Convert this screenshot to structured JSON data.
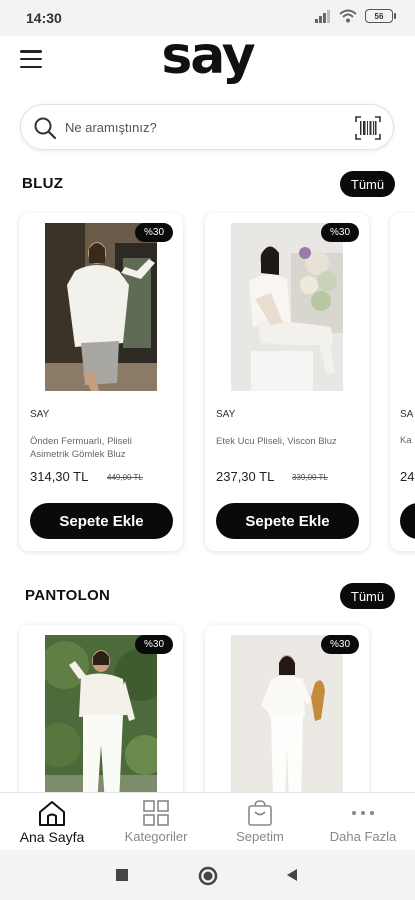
{
  "status": {
    "time": "14:30",
    "battery": "56"
  },
  "header": {
    "logo": "say"
  },
  "search": {
    "placeholder": "Ne aramıştınız?"
  },
  "sections": [
    {
      "title": "BLUZ",
      "all_label": "Tümü",
      "products": [
        {
          "badge": "%30",
          "brand": "SAY",
          "name": "Önden Fermuarlı, Pliseli Asimetrik Gömlek Bluz",
          "price": "314,30 TL",
          "old_price": "449,00 TL",
          "cart_label": "Sepete Ekle"
        },
        {
          "badge": "%30",
          "brand": "SAY",
          "name": "Etek Ucu Pliseli, Viscon Bluz",
          "price": "237,30 TL",
          "old_price": "339,00 TL",
          "cart_label": "Sepete Ekle"
        }
      ],
      "peek": {
        "brand": "SA",
        "name": "Ka",
        "price": "24"
      }
    },
    {
      "title": "PANTOLON",
      "all_label": "Tümü",
      "products": [
        {
          "badge": "%30"
        },
        {
          "badge": "%30"
        }
      ]
    }
  ],
  "tabbar": {
    "items": [
      {
        "label": "Ana Sayfa",
        "icon": "home-icon",
        "active": true
      },
      {
        "label": "Kategoriler",
        "icon": "grid-icon",
        "active": false
      },
      {
        "label": "Sepetim",
        "icon": "bag-icon",
        "active": false
      },
      {
        "label": "Daha Fazla",
        "icon": "more-icon",
        "active": false
      }
    ]
  },
  "colors": {
    "accent": "#0a0a0a",
    "background": "#ffffff",
    "muted": "#888888"
  }
}
